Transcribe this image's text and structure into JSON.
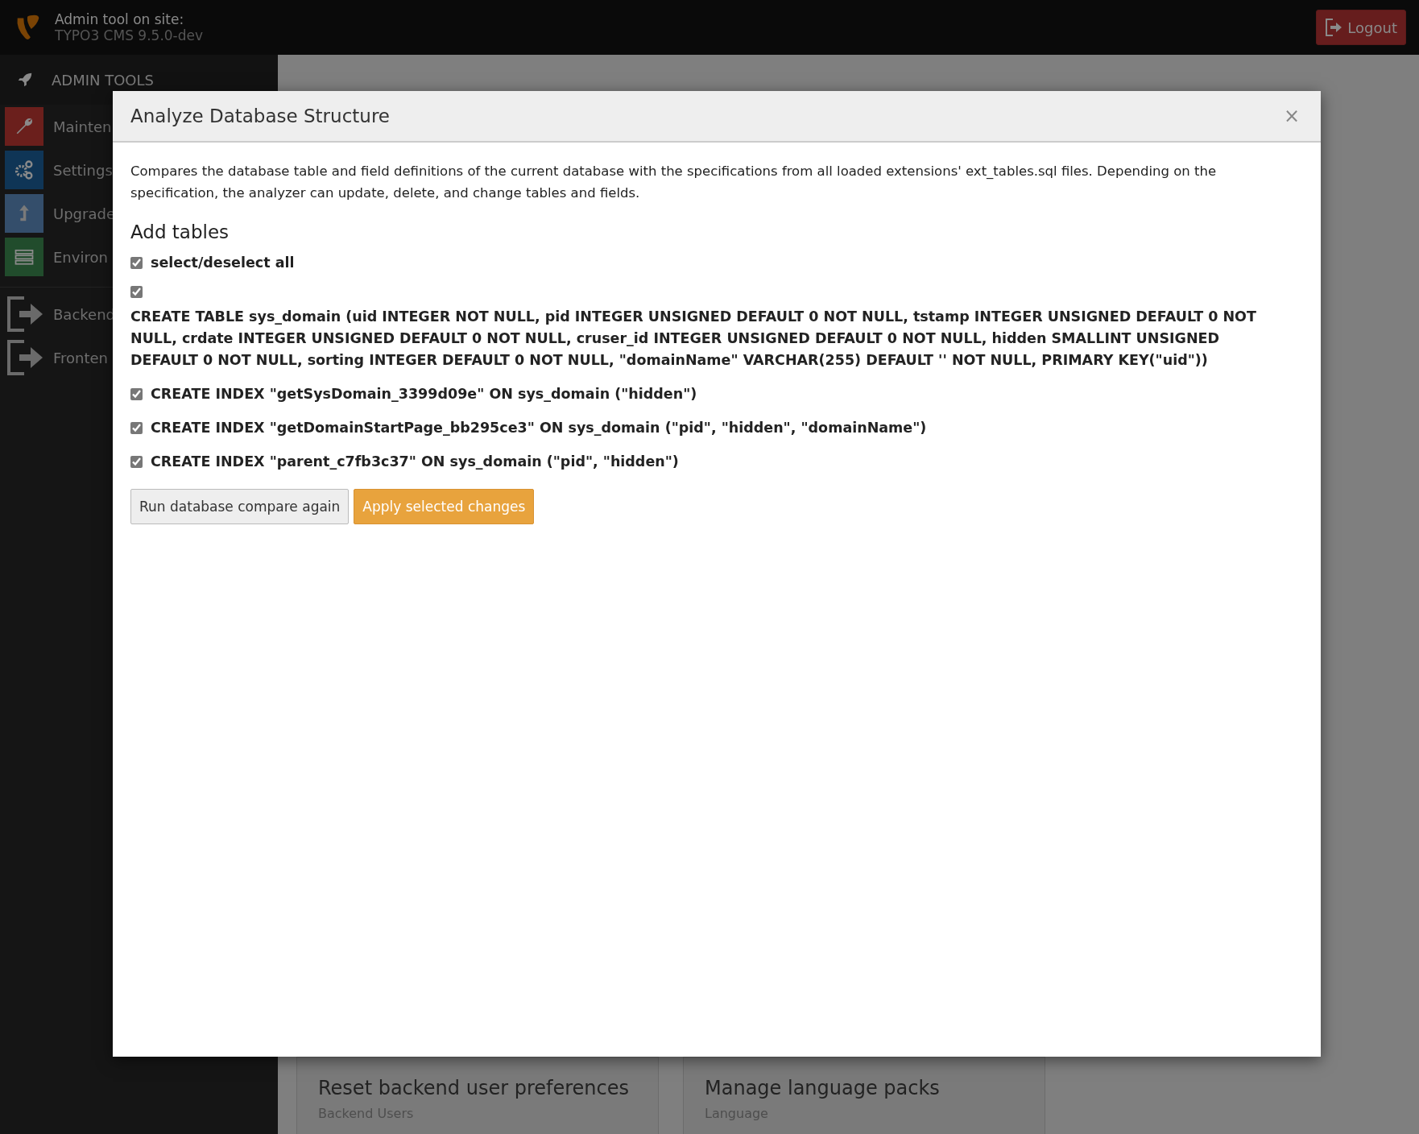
{
  "header": {
    "title": "Admin tool on site:",
    "subtitle": "TYPO3 CMS 9.5.0-dev",
    "logout": "Logout"
  },
  "sidebar": {
    "heading": "ADMIN TOOLS",
    "items": [
      {
        "label": "Mainten",
        "kind": "wrench",
        "color": "#6b1f1c"
      },
      {
        "label": "Settings",
        "kind": "gears",
        "color": "#0f3556"
      },
      {
        "label": "Upgrade",
        "kind": "upgrade",
        "color": "#344e6b"
      },
      {
        "label": "Environ",
        "kind": "server",
        "color": "#214c2c"
      },
      {
        "label": "Backend",
        "kind": "exit"
      },
      {
        "label": "Fronten",
        "kind": "exit"
      }
    ]
  },
  "cards": [
    {
      "title": "Reset backend user preferences",
      "subtitle": "Backend Users"
    },
    {
      "title": "Manage language packs",
      "subtitle": "Language"
    }
  ],
  "modal": {
    "title": "Analyze Database Structure",
    "close": "×",
    "description": "Compares the database table and field definitions of the current database with the specifications from all loaded extensions' ext_tables.sql files. Depending on the specification, the analyzer can update, delete, and change tables and fields.",
    "section": "Add tables",
    "select_all": {
      "label": "select/deselect all",
      "checked": true
    },
    "statements": [
      {
        "kind": "block",
        "checked": true,
        "text": "CREATE TABLE sys_domain (uid INTEGER NOT NULL, pid INTEGER UNSIGNED DEFAULT 0 NOT NULL, tstamp INTEGER UNSIGNED DEFAULT 0 NOT NULL, crdate INTEGER UNSIGNED DEFAULT 0 NOT NULL, cruser_id INTEGER UNSIGNED DEFAULT 0 NOT NULL, hidden SMALLINT UNSIGNED DEFAULT 0 NOT NULL, sorting INTEGER DEFAULT 0 NOT NULL, \"domainName\" VARCHAR(255) DEFAULT '' NOT NULL, PRIMARY KEY(\"uid\"))"
      },
      {
        "kind": "inline",
        "checked": true,
        "text": "CREATE INDEX \"getSysDomain_3399d09e\" ON sys_domain (\"hidden\")"
      },
      {
        "kind": "inline",
        "checked": true,
        "text": "CREATE INDEX \"getDomainStartPage_bb295ce3\" ON sys_domain (\"pid\", \"hidden\", \"domainName\")"
      },
      {
        "kind": "inline",
        "checked": true,
        "text": "CREATE INDEX \"parent_c7fb3c37\" ON sys_domain (\"pid\", \"hidden\")"
      }
    ],
    "buttons": [
      {
        "label": "Run database compare again",
        "kind": "default"
      },
      {
        "label": "Apply selected changes",
        "kind": "warning"
      }
    ]
  }
}
